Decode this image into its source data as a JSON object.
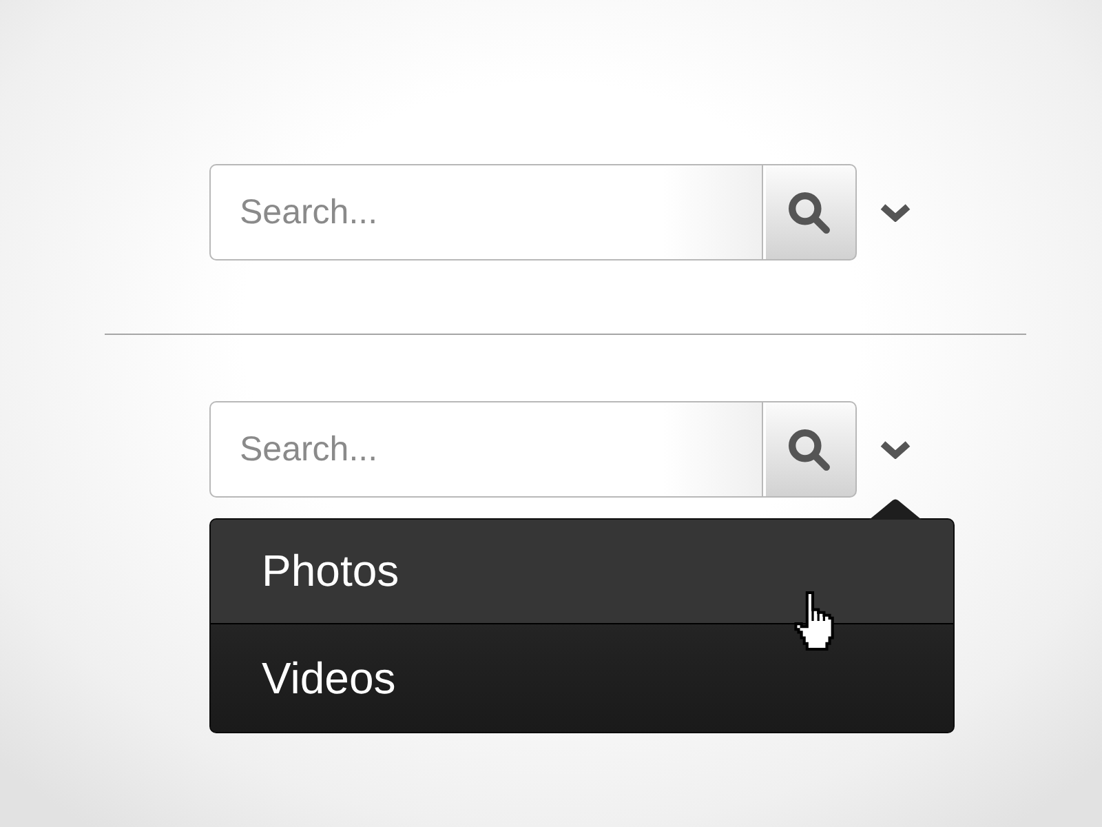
{
  "search_bars": [
    {
      "placeholder": "Search..."
    },
    {
      "placeholder": "Search...",
      "menu": [
        {
          "label": "Photos",
          "hovered": true
        },
        {
          "label": "Videos",
          "hovered": false
        }
      ]
    }
  ]
}
